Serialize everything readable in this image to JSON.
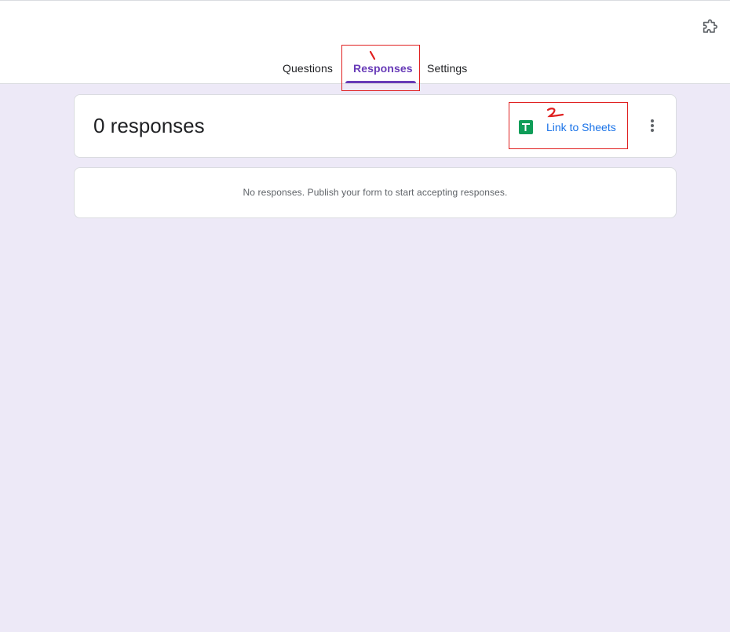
{
  "toolbar": {
    "addon_icon": "puzzle-icon"
  },
  "tabs": [
    {
      "label": "Questions",
      "active": false
    },
    {
      "label": "Responses",
      "active": true
    },
    {
      "label": "Settings",
      "active": false
    }
  ],
  "colors": {
    "accent": "#673ab7",
    "link": "#1a73e8",
    "sheets_green": "#0f9d58",
    "background": "#ede9f7",
    "annotation": "#e02020"
  },
  "summary": {
    "count_label": "0 responses",
    "sheets_icon": "google-sheets-icon",
    "link_label": "Link to Sheets",
    "more_icon": "more-vert-icon"
  },
  "empty_state": {
    "message": "No responses. Publish your form to start accepting responses."
  }
}
